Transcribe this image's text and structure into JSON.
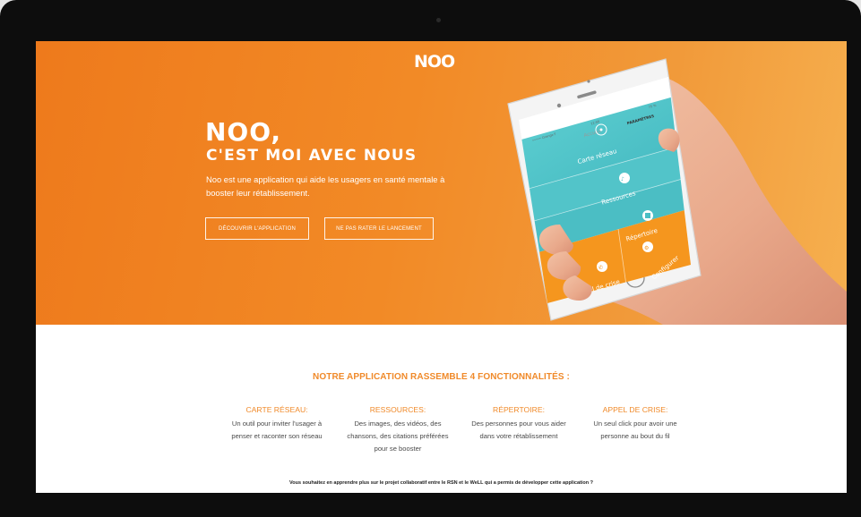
{
  "brand": {
    "logo_text": "NOO"
  },
  "hero": {
    "title": "NOO,",
    "subtitle": "C'EST MOI AVEC NOUS",
    "description": "Noo est une application qui aide les usagers en santé mentale à booster leur rétablissement.",
    "buttons": {
      "discover": "DÉCOUVRIR L'APPLICATION",
      "launch": "NE PAS RATER LE LANCEMENT"
    }
  },
  "phone": {
    "status_left": "••••• Orange F",
    "status_time": "12:00",
    "status_right": "75 %",
    "nav_back": "Accueil",
    "nav_title": "PARAMÈTRES",
    "menu": [
      {
        "label": "Carte réseau",
        "icon": "network-icon"
      },
      {
        "label": "Ressources",
        "icon": "resources-icon"
      },
      {
        "label": "Répertoire",
        "icon": "directory-icon"
      },
      {
        "label": "Appel de crise",
        "icon": "phone-icon"
      },
      {
        "label": "Configurer",
        "icon": "gear-icon"
      }
    ]
  },
  "features": {
    "heading": "NOTRE APPLICATION RASSEMBLE 4 FONCTIONNALITÉS :",
    "items": [
      {
        "title": "CARTE RÉSEAU:",
        "desc_lines": [
          "Un outil pour inviter l'usager à",
          "penser et raconter son réseau"
        ]
      },
      {
        "title": "RESSOURCES:",
        "desc_lines": [
          "Des images, des vidéos, des",
          "chansons, des citations préférées",
          "pour se booster"
        ]
      },
      {
        "title": "RÉPERTOIRE:",
        "desc_lines": [
          "Des personnes pour vous aider",
          "dans votre rétablissement"
        ]
      },
      {
        "title": "APPEL DE CRISE:",
        "desc_lines": [
          "Un seul click pour avoir une",
          "personne au bout du fil"
        ]
      }
    ]
  },
  "footer": {
    "note": "Vous souhaitez en apprendre plus sur le projet collaboratif entre le RSN et le WeLL qui a permis de développer cette application ?"
  },
  "colors": {
    "brand_orange": "#f08a2a",
    "teal": "#4fc3c8",
    "bezel": "#0d0d0d"
  }
}
